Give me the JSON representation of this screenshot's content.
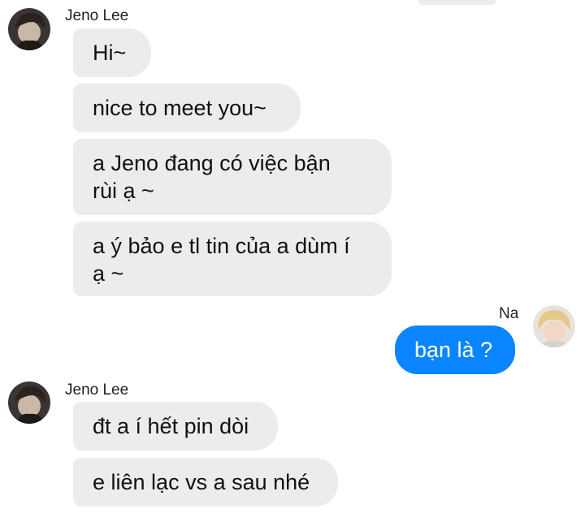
{
  "conversation": {
    "group1": {
      "sender": "Jeno Lee",
      "messages": [
        "Hi~",
        "nice to meet you~",
        "a Jeno đang có việc bận\nrùi ạ ~",
        "a ý bảo e tl tin của a dùm í\nạ ~"
      ]
    },
    "group2": {
      "sender": "Na",
      "messages": [
        "bạn là ?"
      ]
    },
    "group3": {
      "sender": "Jeno Lee",
      "messages": [
        "đt a í hết pin dòi",
        "e liên lạc vs a sau nhé"
      ]
    }
  },
  "colors": {
    "incoming_bubble": "#ececec",
    "outgoing_bubble": "#0a84ff"
  },
  "icons": {
    "jeno_avatar": "avatar-jeno",
    "na_avatar": "avatar-na"
  }
}
